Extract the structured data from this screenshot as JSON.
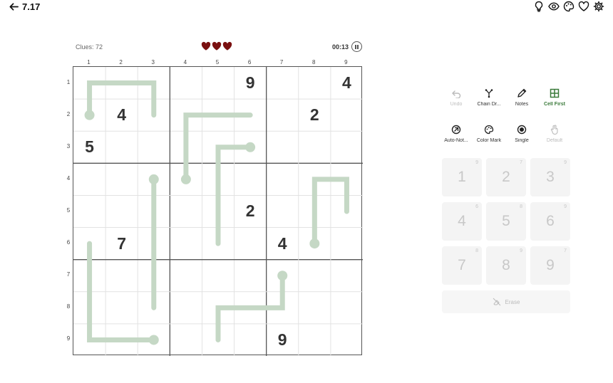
{
  "header": {
    "back_icon": "arrow-left-icon",
    "title": "7.17",
    "icons": [
      "lightbulb-icon",
      "eye-icon",
      "palette-icon",
      "heart-icon",
      "gear-icon"
    ]
  },
  "status": {
    "clues": "Clues: 72",
    "lives": 3,
    "timer": "00:13"
  },
  "colors": {
    "heart": "#7a1010",
    "line": "#c5d8c5",
    "cell_first": "#3a7a3a"
  },
  "columns": [
    "1",
    "2",
    "3",
    "4",
    "5",
    "6",
    "7",
    "8",
    "9"
  ],
  "rows": [
    "1",
    "2",
    "3",
    "4",
    "5",
    "6",
    "7",
    "8",
    "9"
  ],
  "givens": [
    {
      "r": 1,
      "c": 6,
      "v": "9"
    },
    {
      "r": 1,
      "c": 9,
      "v": "4"
    },
    {
      "r": 2,
      "c": 2,
      "v": "4"
    },
    {
      "r": 2,
      "c": 8,
      "v": "2"
    },
    {
      "r": 3,
      "c": 1,
      "v": "5"
    },
    {
      "r": 5,
      "c": 6,
      "v": "2"
    },
    {
      "r": 6,
      "c": 2,
      "v": "7"
    },
    {
      "r": 6,
      "c": 7,
      "v": "4"
    },
    {
      "r": 9,
      "c": 7,
      "v": "9"
    }
  ],
  "lines": [
    {
      "bulb": [
        2,
        1
      ],
      "path": [
        [
          2,
          1
        ],
        [
          1,
          1
        ],
        [
          1,
          3
        ],
        [
          2,
          3
        ]
      ]
    },
    {
      "bulb": [
        4,
        4
      ],
      "path": [
        [
          4,
          4
        ],
        [
          2,
          4
        ],
        [
          2,
          6
        ]
      ]
    },
    {
      "bulb": [
        3,
        6
      ],
      "path": [
        [
          3,
          6
        ],
        [
          3,
          5
        ],
        [
          6,
          5
        ]
      ]
    },
    {
      "bulb": [
        4,
        3
      ],
      "path": [
        [
          4,
          3
        ],
        [
          8,
          3
        ]
      ]
    },
    {
      "bulb": [
        6,
        8
      ],
      "path": [
        [
          6,
          8
        ],
        [
          4,
          8
        ],
        [
          4,
          9
        ],
        [
          5,
          9
        ]
      ]
    },
    {
      "bulb": [
        9,
        3
      ],
      "path": [
        [
          9,
          3
        ],
        [
          9,
          1
        ],
        [
          6,
          1
        ]
      ]
    },
    {
      "bulb": [
        7,
        7
      ],
      "path": [
        [
          7,
          7
        ],
        [
          8,
          7
        ],
        [
          8,
          5
        ],
        [
          9,
          5
        ]
      ]
    }
  ],
  "tools_row1": [
    {
      "label": "Undo",
      "icon": "undo-icon",
      "state": "disabled"
    },
    {
      "label": "Chain Dr...",
      "icon": "chain-icon",
      "state": "normal"
    },
    {
      "label": "Notes",
      "icon": "pencil-icon",
      "state": "normal"
    },
    {
      "label": "Cell First",
      "icon": "grid-icon",
      "state": "active"
    }
  ],
  "tools_row2": [
    {
      "label": "Auto-Not...",
      "icon": "auto-notes-icon",
      "state": "normal"
    },
    {
      "label": "Color Mark",
      "icon": "palette-icon",
      "state": "normal"
    },
    {
      "label": "Single",
      "icon": "radio-icon",
      "state": "normal"
    },
    {
      "label": "Default",
      "icon": "hand-icon",
      "state": "disabled"
    }
  ],
  "numpad": [
    {
      "num": "1",
      "count": "9"
    },
    {
      "num": "2",
      "count": "7"
    },
    {
      "num": "3",
      "count": "9"
    },
    {
      "num": "4",
      "count": "6"
    },
    {
      "num": "5",
      "count": "8"
    },
    {
      "num": "6",
      "count": "9"
    },
    {
      "num": "7",
      "count": "8"
    },
    {
      "num": "8",
      "count": "9"
    },
    {
      "num": "9",
      "count": "7"
    }
  ],
  "erase_label": "Erase"
}
